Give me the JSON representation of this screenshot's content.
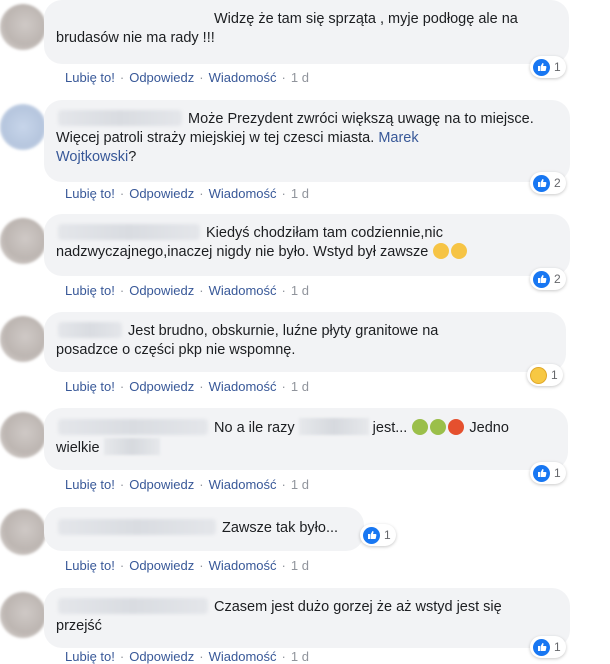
{
  "actions": {
    "like": "Lubię to!",
    "reply": "Odpowiedz",
    "message": "Wiadomość",
    "sep": "·"
  },
  "comments": [
    {
      "line1": "Widzę że tam się sprząta , myje podłogę ale na",
      "line2": "brudasów nie ma rady !!!",
      "time": "1 d",
      "reactions": "1",
      "reaction_type": "like"
    },
    {
      "line1": "Może Prezydent zwróci większą uwagę na to miejsce.",
      "line2": "Więcej patroli straży miejskiej w tej czesci miasta.",
      "mention_a": "Marek",
      "mention_b": "Wojtkowski",
      "time": "1 d",
      "reactions": "2",
      "reaction_type": "like"
    },
    {
      "line1": "Kiedyś chodziłam tam codziennie,nic",
      "line2": "nadzwyczajnego,inaczej nigdy nie było. Wstyd był zawsze",
      "time": "1 d",
      "reactions": "2",
      "reaction_type": "like"
    },
    {
      "line1": "Jest brudno, obskurnie, luźne płyty granitowe na",
      "line2": "posadzce o części pkp nie wspomnę.",
      "time": "1 d",
      "reactions": "1",
      "reaction_type": "haha"
    },
    {
      "line1_a": "No a ile razy",
      "line1_b": "jest...",
      "line1_c": "Jedno",
      "line2": "wielkie",
      "time": "1 d",
      "reactions": "1",
      "reaction_type": "like"
    },
    {
      "line1": "Zawsze tak było...",
      "time": "1 d",
      "reactions": "1",
      "reaction_type": "like"
    },
    {
      "line1": "Czasem jest dużo gorzej że aż wstyd jest się",
      "line2": "przejść",
      "time": "1 d",
      "reactions": "1",
      "reaction_type": "like"
    }
  ],
  "colors": {
    "link": "#385898",
    "bubble": "#f2f3f5",
    "like": "#1877f2",
    "meta": "#90949c"
  }
}
